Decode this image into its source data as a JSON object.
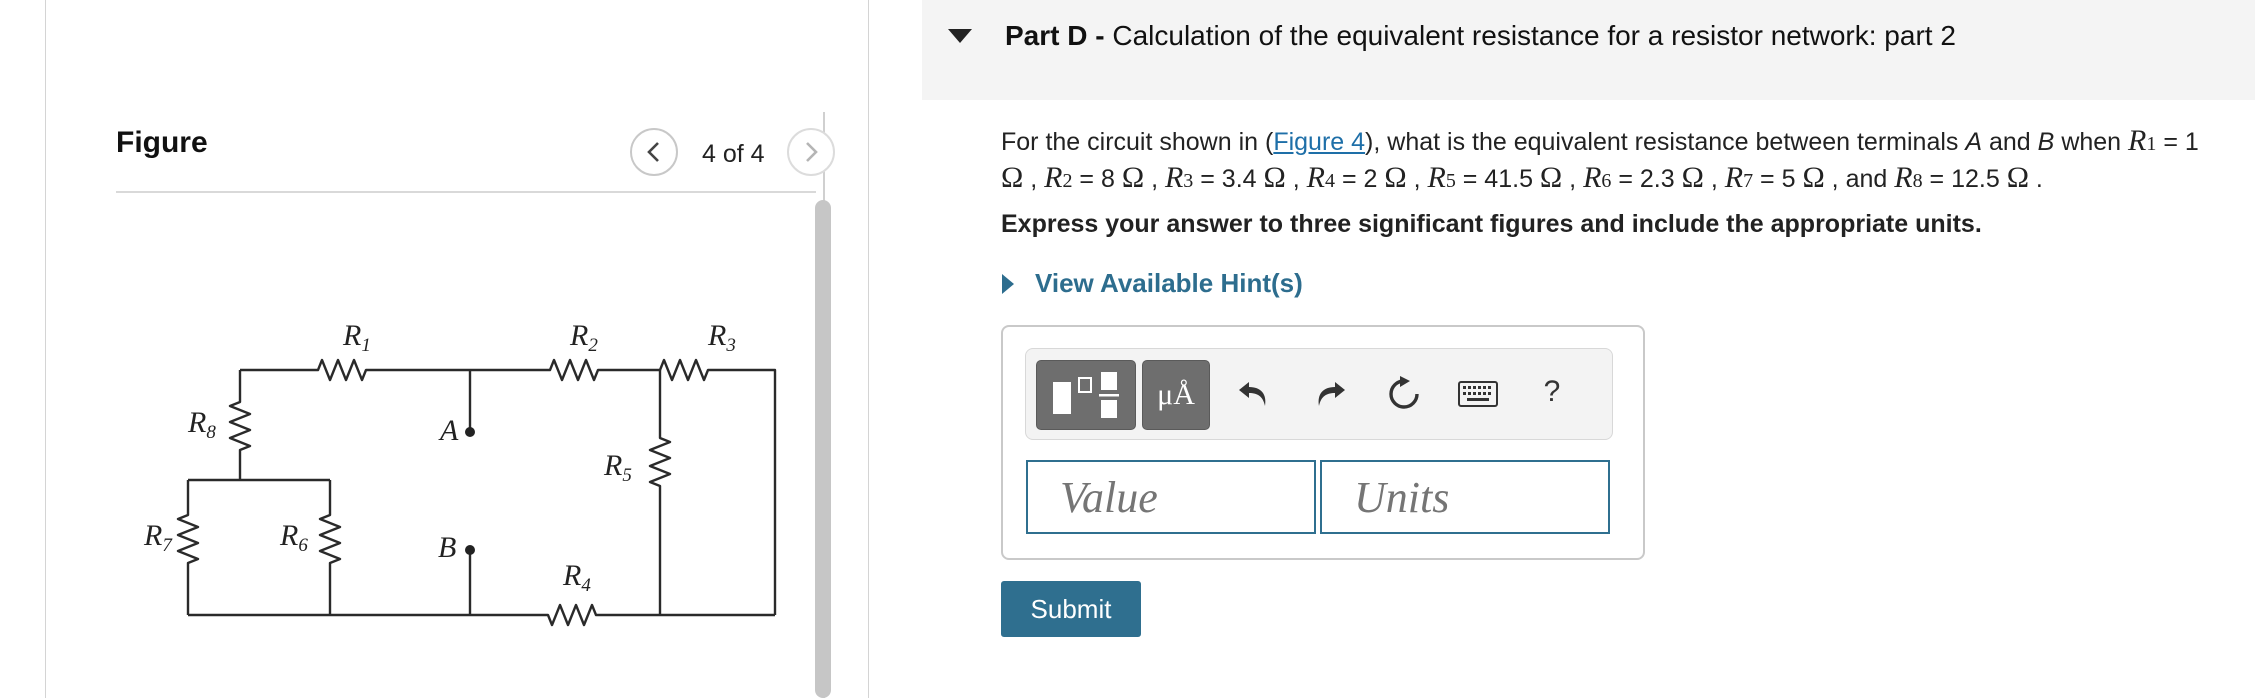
{
  "figure_panel": {
    "title": "Figure",
    "counter": "4 of 4",
    "circuit": {
      "labels": [
        {
          "name": "R1-label",
          "main": "R",
          "sub": "1"
        },
        {
          "name": "R2-label",
          "main": "R",
          "sub": "2"
        },
        {
          "name": "R3-label",
          "main": "R",
          "sub": "3"
        },
        {
          "name": "R4-label",
          "main": "R",
          "sub": "4"
        },
        {
          "name": "R5-label",
          "main": "R",
          "sub": "5"
        },
        {
          "name": "R6-label",
          "main": "R",
          "sub": "6"
        },
        {
          "name": "R7-label",
          "main": "R",
          "sub": "7"
        },
        {
          "name": "R8-label",
          "main": "R",
          "sub": "8"
        }
      ],
      "terminal_a": "A",
      "terminal_b": "B"
    }
  },
  "part": {
    "prefix": "Part D -",
    "title": "Calculation of the equivalent resistance for a resistor network: part 2"
  },
  "question": {
    "line1_before_link": "For the circuit shown in (",
    "link_text": "Figure 4",
    "line1_after_link": "), what is the equivalent resistance between terminals",
    "term_a": "A",
    "and_word": "and",
    "term_b": "B",
    "when_word": "when",
    "values": [
      {
        "sub": "1",
        "val": "= 1"
      },
      {
        "sub": "2",
        "val": "= 8"
      },
      {
        "sub": "3",
        "val": "= 3.4"
      },
      {
        "sub": "4",
        "val": "= 2"
      },
      {
        "sub": "5",
        "val": "= 41.5"
      },
      {
        "sub": "6",
        "val": "= 2.3"
      },
      {
        "sub": "7",
        "val": "= 5"
      },
      {
        "sub": "8",
        "val": "= 12.5"
      }
    ],
    "and_final": "and",
    "ohm": "Ω"
  },
  "instruction": "Express your answer to three significant figures and include the appropriate units.",
  "hint_label": "View Available Hint(s)",
  "toolbar": {
    "units_symbol": "μÅ",
    "help_symbol": "?"
  },
  "inputs": {
    "value_placeholder": "Value",
    "units_placeholder": "Units"
  },
  "submit_label": "Submit"
}
